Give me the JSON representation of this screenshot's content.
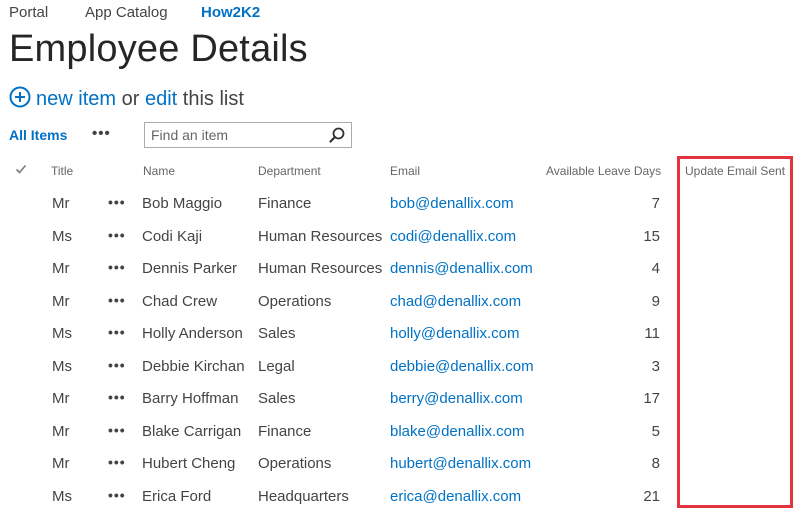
{
  "top_nav": {
    "items": [
      "Portal",
      "App Catalog",
      "How2K2"
    ],
    "active": "How2K2"
  },
  "page": {
    "title": "Employee Details"
  },
  "actions": {
    "new_item": "new item",
    "or": "or",
    "edit": "edit",
    "this_list": "this list"
  },
  "view": {
    "label": "All Items",
    "more": "•••"
  },
  "search": {
    "placeholder": "Find an item"
  },
  "table": {
    "columns": {
      "title": "Title",
      "name": "Name",
      "department": "Department",
      "email": "Email",
      "leave": "Available Leave Days",
      "update_sent": "Update Email Sent"
    },
    "row_menu": "•••",
    "rows": [
      {
        "title": "Mr",
        "name": "Bob Maggio",
        "department": "Finance",
        "email": "bob@denallix.com",
        "leave": "7",
        "update_sent": ""
      },
      {
        "title": "Ms",
        "name": "Codi Kaji",
        "department": "Human Resources",
        "email": "codi@denallix.com",
        "leave": "15",
        "update_sent": ""
      },
      {
        "title": "Mr",
        "name": "Dennis Parker",
        "department": "Human Resources",
        "email": "dennis@denallix.com",
        "leave": "4",
        "update_sent": ""
      },
      {
        "title": "Mr",
        "name": "Chad Crew",
        "department": "Operations",
        "email": "chad@denallix.com",
        "leave": "9",
        "update_sent": ""
      },
      {
        "title": "Ms",
        "name": "Holly Anderson",
        "department": "Sales",
        "email": "holly@denallix.com",
        "leave": "11",
        "update_sent": ""
      },
      {
        "title": "Ms",
        "name": "Debbie Kirchan",
        "department": "Legal",
        "email": "debbie@denallix.com",
        "leave": "3",
        "update_sent": ""
      },
      {
        "title": "Mr",
        "name": "Barry Hoffman",
        "department": "Sales",
        "email": "berry@denallix.com",
        "leave": "17",
        "update_sent": ""
      },
      {
        "title": "Mr",
        "name": "Blake Carrigan",
        "department": "Finance",
        "email": "blake@denallix.com",
        "leave": "5",
        "update_sent": ""
      },
      {
        "title": "Mr",
        "name": "Hubert Cheng",
        "department": "Operations",
        "email": "hubert@denallix.com",
        "leave": "8",
        "update_sent": ""
      },
      {
        "title": "Ms",
        "name": "Erica Ford",
        "department": "Headquarters",
        "email": "erica@denallix.com",
        "leave": "21",
        "update_sent": ""
      }
    ]
  },
  "colors": {
    "link": "#0072c6",
    "highlight": "#e3343f",
    "text": "#444444"
  },
  "icons": [
    "plus-circle-icon",
    "search-icon",
    "checkmark-icon",
    "ellipsis-icon"
  ]
}
